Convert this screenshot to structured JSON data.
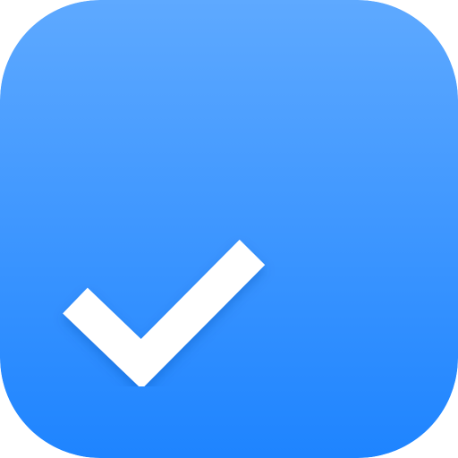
{
  "icon": {
    "name": "checkmark-icon",
    "colors": {
      "gradient_top": "#5EA9FF",
      "gradient_bottom": "#1E84FF",
      "glyph": "#FFFFFF"
    }
  }
}
